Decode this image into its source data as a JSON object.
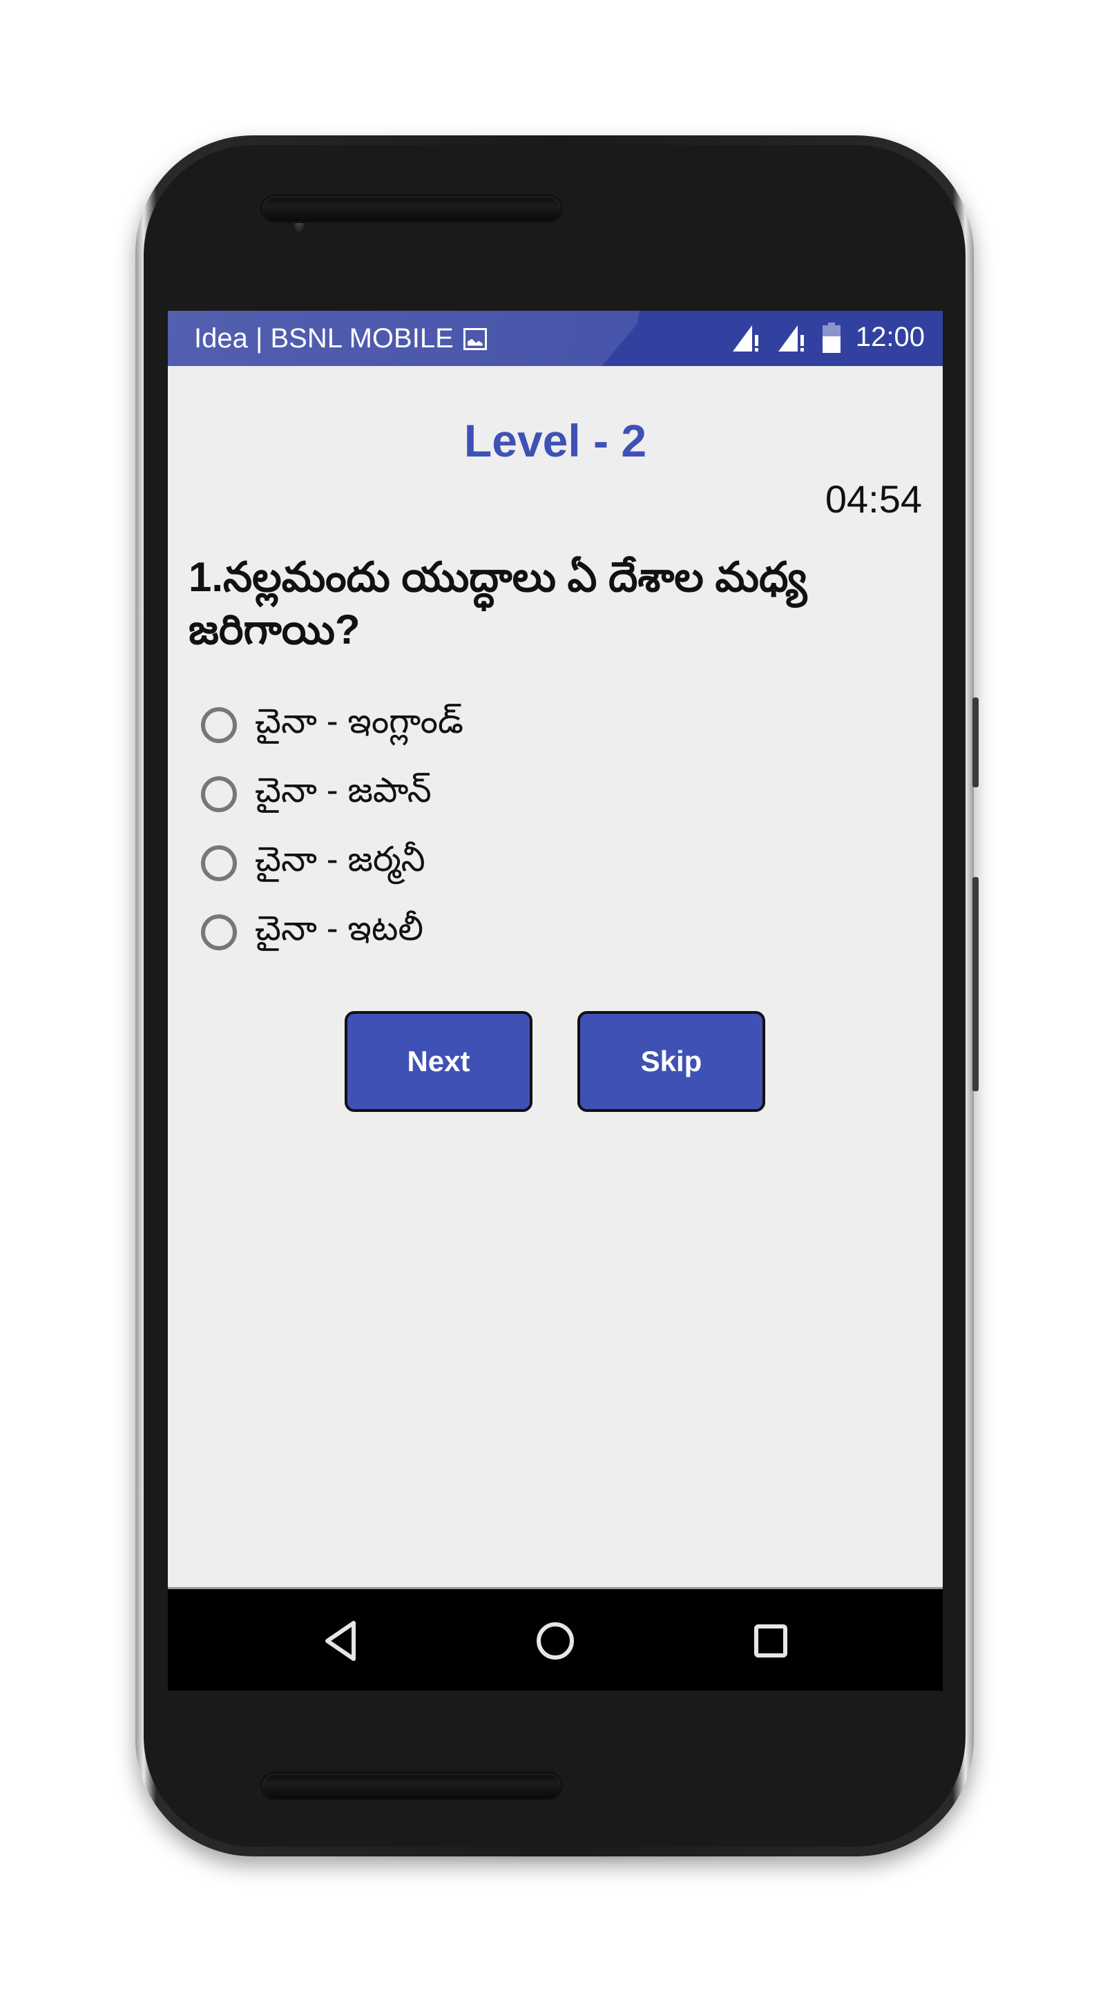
{
  "status_bar": {
    "carrier": "Idea | BSNL MOBILE",
    "notification_icon": "image-icon",
    "signal_icons": [
      "signal-no-data-icon",
      "signal-no-data-icon"
    ],
    "battery_icon": "battery-icon",
    "time": "12:00"
  },
  "quiz": {
    "level_title": "Level - 2",
    "timer": "04:54",
    "question": "1.నల్లమందు యుద్ధాలు ఏ దేశాల మధ్య జరిగాయి?",
    "options": [
      {
        "label": "చైనా - ఇంగ్లాండ్",
        "selected": false
      },
      {
        "label": "చైనా - జపాన్",
        "selected": false
      },
      {
        "label": "చైనా - జర్మనీ",
        "selected": false
      },
      {
        "label": "చైనా - ఇటలీ",
        "selected": false
      }
    ],
    "next_label": "Next",
    "skip_label": "Skip"
  },
  "nav_bar": {
    "back_icon": "back-triangle-icon",
    "home_icon": "home-circle-icon",
    "recents_icon": "recents-square-icon"
  },
  "colors": {
    "primary": "#3f51b5",
    "status_bar": "#3241a0",
    "background": "#eeeeee",
    "nav_bar": "#000000"
  }
}
